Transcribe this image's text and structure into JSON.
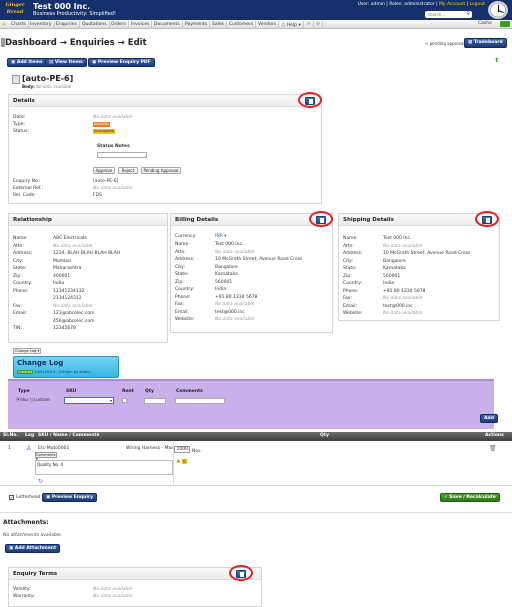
{
  "header": {
    "logo": "Ginger Bread Traders",
    "title": "Test 000 Inc.",
    "subtitle": "Business Productivity: Simplified!",
    "user": "User: admin | Roles: administrator |",
    "my_account": "My Account",
    "logout": "Logout",
    "search_placeholder": "search..."
  },
  "nav": {
    "items": [
      "Charts",
      "Inventory",
      "Enquiries",
      "Quotations",
      "Orders",
      "Invoices",
      "Documents",
      "Payments",
      "Sales",
      "Customers",
      "Vendors",
      "Help"
    ],
    "cashe": "Cashe"
  },
  "page": {
    "title": "Dashboard → Enquiries → Edit",
    "pending": "< pending approvals",
    "tradeboard": "Tradeboard"
  },
  "toolbar": {
    "add_items": "Add Items",
    "view_items": "View Items",
    "preview_pdf": "Preview Enquiry PDF"
  },
  "doc": {
    "title": "[auto-PE-6]",
    "body_label": "Body:",
    "body_value": "No data available"
  },
  "details": {
    "heading": "Details",
    "date_label": "Date:",
    "date_value": "No data available",
    "type_label": "Type:",
    "type_value": "portfolio",
    "status_label": "Status:",
    "status_value": "incomplete",
    "status_notes": "Status Notes",
    "approve": "Approve",
    "reject": "Reject",
    "pending_approval": "Pending Approval",
    "enq_label": "Enquiry No.:",
    "enq_value": "[auto-PE-6]",
    "ext_label": "External Ref.:",
    "ext_value": "No data available",
    "rel_label": "Rel. Code:",
    "rel_value": "FDS"
  },
  "relationship": {
    "heading": "Relationship",
    "rows": [
      [
        "Name:",
        "ABC Electricals"
      ],
      [
        "Attn:",
        "No data available"
      ],
      [
        "Address:",
        "1234, BLAH BLAH BLAH BLAH"
      ],
      [
        "City:",
        "Mumbai"
      ],
      [
        "State:",
        "Maharashtra"
      ],
      [
        "Zip:",
        "400001"
      ],
      [
        "Country:",
        "India"
      ],
      [
        "Phone:",
        "12341234132"
      ],
      [
        "",
        "2134124312"
      ],
      [
        "Fax:",
        "No data available"
      ],
      [
        "Email:",
        "123@abcelec.com"
      ],
      [
        "",
        "456@abcelec.com"
      ],
      [
        "TIN:",
        "12345678"
      ]
    ]
  },
  "billing": {
    "heading": "Billing Details",
    "currency_label": "Currency:",
    "currency_value": "INR",
    "rows": [
      [
        "Name:",
        "Test 000 Inc."
      ],
      [
        "Attn:",
        "No data available"
      ],
      [
        "Address:",
        "10 McGrath Street, Avenue Road Cross"
      ],
      [
        "City:",
        "Bangalore"
      ],
      [
        "State:",
        "Karnataka"
      ],
      [
        "Zip:",
        "560001"
      ],
      [
        "Country:",
        "India"
      ],
      [
        "Phone:",
        "+91 80 1234 5678"
      ],
      [
        "Fax:",
        "No data available"
      ],
      [
        "Email:",
        "test@000.inc"
      ],
      [
        "Website:",
        "No data available"
      ]
    ]
  },
  "shipping": {
    "heading": "Shipping Details",
    "rows": [
      [
        "Name:",
        "Test 000 Inc."
      ],
      [
        "Attn:",
        "No data available"
      ],
      [
        "Address:",
        "10 McGrath Street, Avenue Road Cross"
      ],
      [
        "City:",
        "Bangalore"
      ],
      [
        "State:",
        "Karnataka"
      ],
      [
        "Zip:",
        "560001"
      ],
      [
        "Country:",
        "India"
      ],
      [
        "Phone:",
        "+91 80 1234 5678"
      ],
      [
        "Fax:",
        "No data available"
      ],
      [
        "Email:",
        "test@000.inc"
      ],
      [
        "Website:",
        "No data available"
      ]
    ]
  },
  "changelog": {
    "tiny": "Change Log",
    "title": "Change Log",
    "badge": "Created",
    "entry": "14/01/2013 - 2:09pm by admin"
  },
  "additem": {
    "type_label": "Type",
    "sku_opt": "sku",
    "custom_opt": "custom",
    "sku_label": "SKU",
    "rent_label": "Rent",
    "qty_label": "Qty",
    "comments_label": "Comments",
    "add": "Add"
  },
  "table": {
    "headers": [
      "Sl.No.",
      "Log",
      "SKU / Name / Comments",
      "Qty",
      "Actions"
    ],
    "row": {
      "sl": "1",
      "sku": "Etc-Moto0001",
      "comments_sel": "Comments",
      "name": "Wiring Harness - Main",
      "qty": "1000",
      "unit": "Nos.",
      "notes": "Quality No. 4",
      "stock_badge": "0"
    }
  },
  "footer": {
    "letterhead": "Letterhead",
    "preview": "Preview Enquiry",
    "save": "Save / Recalculate"
  },
  "attachments": {
    "heading": "Attachments:",
    "none": "No attachments available.",
    "add": "Add Attachment"
  },
  "terms": {
    "heading": "Enquiry Terms",
    "validity_label": "Validity:",
    "validity_value": "No data available",
    "warranty_label": "Warranty:",
    "warranty_value": "No data available"
  }
}
